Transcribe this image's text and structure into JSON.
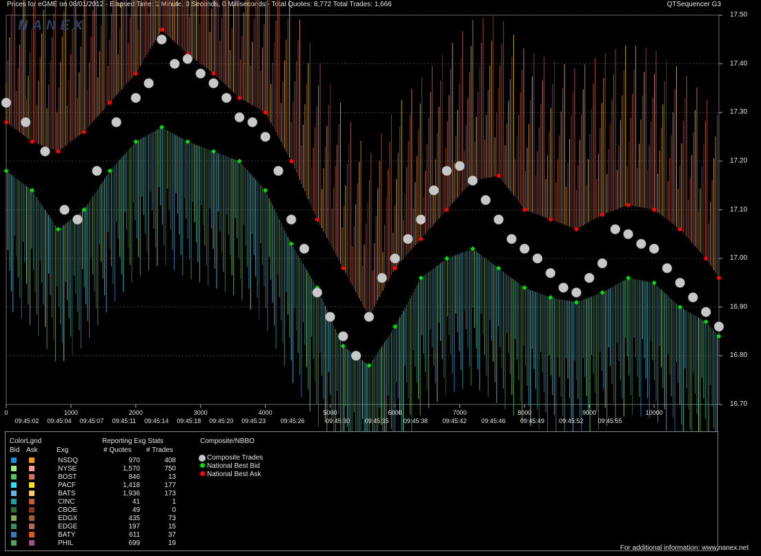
{
  "header": {
    "title": "Prices for  eGME  on  08/01/2012  -  Elapsed Time: 1 Minute, 0 Seconds, 0 Milliseconds  -  Total Quotes: 8,772  Total Trades: 1,666",
    "product": "QTSequencer G3",
    "logo": "NANEX"
  },
  "colors": {
    "background": "#000000",
    "composite_trade": "#c8c8c8",
    "nbb": "#00e000",
    "nbo": "#ff0000",
    "ask_lines": "#b04428",
    "bid_lines": "#5fa4c8"
  },
  "chart_data": {
    "type": "scatter",
    "ylim": [
      16.7,
      17.5
    ],
    "xlim": [
      0,
      11000
    ],
    "y_ticks": [
      "17.50",
      "17.40",
      "17.30",
      "17.20",
      "17.10",
      "17.00",
      "16.90",
      "16.80",
      "16.70"
    ],
    "x_ticks": [
      "0",
      "1000",
      "2000",
      "3000",
      "4000",
      "5000",
      "6000",
      "7000",
      "8000",
      "9000",
      "10000"
    ],
    "time_ticks": [
      "09:45:02",
      "09:45:04",
      "09:45:07",
      "09:45:11",
      "09:45:14",
      "09:45:18",
      "09:45:20",
      "09:45:23",
      "09:45:26",
      "09:45:30",
      "09:45:35",
      "09:45:38",
      "09:45:42",
      "09:45:46",
      "09:45:49",
      "09:45:52",
      "09:45:55"
    ],
    "time_tick_x": [
      0,
      500,
      1000,
      1500,
      2000,
      2500,
      3000,
      3500,
      4100,
      4800,
      5400,
      6000,
      6600,
      7200,
      7800,
      8400,
      9000
    ],
    "series": [
      {
        "name": "Composite Trades",
        "x": [
          0,
          300,
          600,
          900,
          1100,
          1400,
          1700,
          2000,
          2200,
          2400,
          2600,
          2800,
          3000,
          3200,
          3400,
          3600,
          3800,
          4000,
          4200,
          4400,
          4600,
          4800,
          5000,
          5200,
          5400,
          5600,
          5800,
          6000,
          6200,
          6400,
          6600,
          6800,
          7000,
          7200,
          7400,
          7600,
          7800,
          8000,
          8200,
          8400,
          8600,
          8800,
          9000,
          9200,
          9400,
          9600,
          9800,
          10000,
          10200,
          10400,
          10600,
          10800,
          11000
        ],
        "y": [
          17.32,
          17.28,
          17.22,
          17.1,
          17.08,
          17.18,
          17.28,
          17.33,
          17.36,
          17.45,
          17.4,
          17.41,
          17.38,
          17.36,
          17.33,
          17.29,
          17.28,
          17.25,
          17.18,
          17.08,
          17.02,
          16.93,
          16.88,
          16.84,
          16.8,
          16.88,
          16.96,
          17.0,
          17.04,
          17.08,
          17.14,
          17.18,
          17.19,
          17.16,
          17.12,
          17.08,
          17.04,
          17.02,
          17.0,
          16.97,
          16.94,
          16.93,
          16.96,
          16.99,
          17.06,
          17.05,
          17.03,
          17.02,
          16.98,
          16.95,
          16.92,
          16.89,
          16.86
        ]
      },
      {
        "name": "National Best Bid",
        "x": [
          0,
          400,
          800,
          1200,
          1600,
          2000,
          2400,
          2800,
          3200,
          3600,
          4000,
          4400,
          4800,
          5200,
          5600,
          6000,
          6400,
          6800,
          7200,
          7600,
          8000,
          8400,
          8800,
          9200,
          9600,
          10000,
          10400,
          10800,
          11000
        ],
        "y": [
          17.18,
          17.14,
          17.06,
          17.1,
          17.18,
          17.24,
          17.27,
          17.24,
          17.22,
          17.2,
          17.14,
          17.03,
          16.94,
          16.82,
          16.78,
          16.86,
          16.96,
          17.0,
          17.02,
          16.98,
          16.94,
          16.92,
          16.91,
          16.93,
          16.96,
          16.95,
          16.9,
          16.87,
          16.84
        ]
      },
      {
        "name": "National Best Ask",
        "x": [
          0,
          400,
          800,
          1200,
          1600,
          2000,
          2400,
          2800,
          3200,
          3600,
          4000,
          4400,
          4800,
          5200,
          5600,
          6000,
          6400,
          6800,
          7200,
          7600,
          8000,
          8400,
          8800,
          9200,
          9600,
          10000,
          10400,
          10800,
          11000
        ],
        "y": [
          17.28,
          17.24,
          17.22,
          17.26,
          17.32,
          17.38,
          17.47,
          17.42,
          17.38,
          17.33,
          17.3,
          17.2,
          17.08,
          16.98,
          16.88,
          16.98,
          17.04,
          17.1,
          17.16,
          17.17,
          17.1,
          17.08,
          17.06,
          17.09,
          17.11,
          17.1,
          17.06,
          17.0,
          16.96
        ]
      }
    ]
  },
  "legend": {
    "color_title": "ColorLgnd",
    "bid_header": "Bid",
    "ask_header": "Ask",
    "stats_title": "Reporting Exg Stats",
    "exg_header": "Exg",
    "quotes_header": "# Quotes",
    "trades_header": "# Trades",
    "nbbo_title": "Composite/NBBO",
    "nbbo_items": [
      "Composite Trades",
      "National Best Bid",
      "National Best Ask"
    ],
    "rows": [
      {
        "exg": "NSDQ",
        "quotes": "970",
        "trades": "408",
        "bid": "#1a8fe0",
        "ask": "#ff9a1a"
      },
      {
        "exg": "NYSE",
        "quotes": "1,570",
        "trades": "750",
        "bid": "#9cf07c",
        "ask": "#ff9a9a"
      },
      {
        "exg": "BOST",
        "quotes": "846",
        "trades": "13",
        "bid": "#58c058",
        "ask": "#d87060"
      },
      {
        "exg": "PACF",
        "quotes": "1,418",
        "trades": "177",
        "bid": "#30e0f0",
        "ask": "#ffe020"
      },
      {
        "exg": "BATS",
        "quotes": "1,936",
        "trades": "173",
        "bid": "#64b4e4",
        "ask": "#ffc870"
      },
      {
        "exg": "CINC",
        "quotes": "41",
        "trades": "1",
        "bid": "#1ea0a0",
        "ask": "#c85a2a"
      },
      {
        "exg": "CBOE",
        "quotes": "49",
        "trades": "0",
        "bid": "#2e6e2e",
        "ask": "#8a3a1a"
      },
      {
        "exg": "EDGX",
        "quotes": "435",
        "trades": "73",
        "bid": "#82b05a",
        "ask": "#a85a32"
      },
      {
        "exg": "EDGE",
        "quotes": "197",
        "trades": "15",
        "bid": "#3e8c5a",
        "ask": "#b86a5a"
      },
      {
        "exg": "BATY",
        "quotes": "611",
        "trades": "37",
        "bid": "#3a7ab8",
        "ask": "#e05a14"
      },
      {
        "exg": "PHIL",
        "quotes": "699",
        "trades": "19",
        "bid": "#5aa05a",
        "ask": "#a0508a"
      }
    ]
  },
  "footer": {
    "text": "For additional information: www.nanex.net"
  }
}
